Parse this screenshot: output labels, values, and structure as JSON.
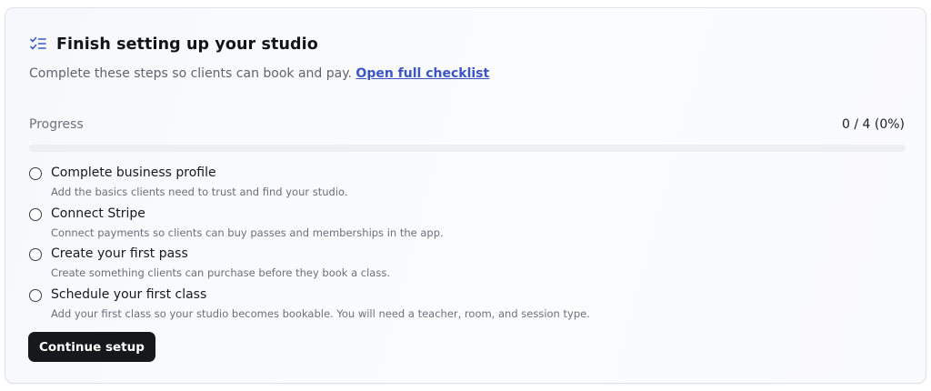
{
  "header": {
    "icon": "checklist-icon",
    "title": "Finish setting up your studio"
  },
  "subtitle": {
    "text": "Complete these steps so clients can book and pay.",
    "link_label": "Open full checklist"
  },
  "progress": {
    "label": "Progress",
    "value_text": "0 / 4 (0%)",
    "completed": 0,
    "total": 4,
    "fraction": 0
  },
  "steps": [
    {
      "title": "Complete business profile",
      "description": "Add the basics clients need to trust and find your studio.",
      "completed": false
    },
    {
      "title": "Connect Stripe",
      "description": "Connect payments so clients can buy passes and memberships in the app.",
      "completed": false
    },
    {
      "title": "Create your first pass",
      "description": "Create something clients can purchase before they book a class.",
      "completed": false
    },
    {
      "title": "Schedule your first class",
      "description": "Add your first class so your studio becomes bookable. You will need a teacher, room, and session type.",
      "completed": false
    }
  ],
  "actions": {
    "continue_label": "Continue setup"
  },
  "colors": {
    "link": "#3b55c9",
    "button_bg": "#16181c",
    "icon_accent": "#3b55c9"
  }
}
